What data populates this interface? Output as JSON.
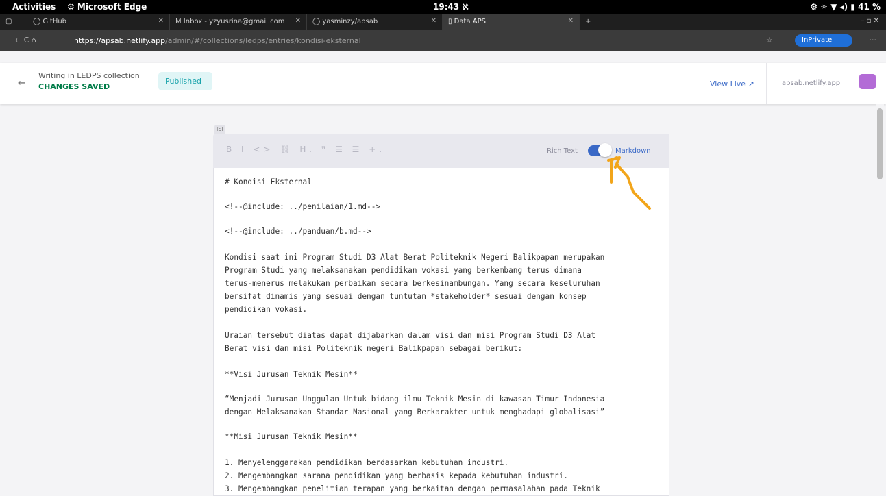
{
  "system": {
    "activities": "Activities",
    "app": "⚙ Microsoft Edge",
    "clock": "19:43 ℵ",
    "tray": "⚙   ☼ ▼ ◂) ▮ 41 %"
  },
  "tabs": [
    {
      "label": "◯ GitHub"
    },
    {
      "label": "M Inbox - yzyusrina@gmail.com"
    },
    {
      "label": "◯ yasminzy/apsab"
    },
    {
      "label": "▯ Data APS"
    }
  ],
  "window_controls": "–   ▫   ✕",
  "url": {
    "host": "https://apsab.netlify.app",
    "path": "/admin/#/collections/ledps/entries/kondisi-eksternal"
  },
  "inprivate": "InPrivate",
  "cms": {
    "writing": "Writing in LEDPS collection",
    "status": "CHANGES SAVED",
    "published": "Published",
    "view_live": "View Live ↗",
    "site": "apsab.netlify.app"
  },
  "field": {
    "label": "ISI",
    "mode_left": "Rich Text",
    "mode_right": "Markdown",
    "toolbar_icons": "B I <> ⛓ H. ❞ ☰ ☰ +."
  },
  "body_lines": [
    "# Kondisi Eksternal",
    "<!--@include: ../penilaian/1.md-->",
    "<!--@include: ../panduan/b.md-->",
    "Kondisi saat ini Program Studi D3 Alat Berat Politeknik Negeri Balikpapan merupakan",
    "Program Studi yang melaksanakan pendidikan vokasi yang berkembang terus dimana",
    "terus-menerus melakukan perbaikan secara berkesinambungan. Yang secara keseluruhan",
    "bersifat dinamis yang sesuai dengan tuntutan *stakeholder* sesuai dengan konsep",
    "pendidikan vokasi.",
    "Uraian tersebut diatas dapat dijabarkan dalam visi dan misi Program Studi D3 Alat",
    "Berat visi dan misi Politeknik negeri Balikpapan sebagai berikut:",
    "**Visi Jurusan Teknik Mesin**",
    "“Menjadi Jurusan Unggulan Untuk bidang ilmu Teknik Mesin di kawasan Timur Indonesia",
    "dengan Melaksanakan Standar Nasional yang Berkarakter untuk menghadapi globalisasi”",
    "**Misi Jurusan Teknik Mesin**",
    "1. Menyelenggarakan pendidikan berdasarkan kebutuhan industri.",
    "2. Mengembangkan sarana pendidikan yang berbasis kepada kebutuhan industri.",
    "3. Mengembangkan penelitian terapan yang berkaitan dengan permasalahan pada Teknik"
  ]
}
